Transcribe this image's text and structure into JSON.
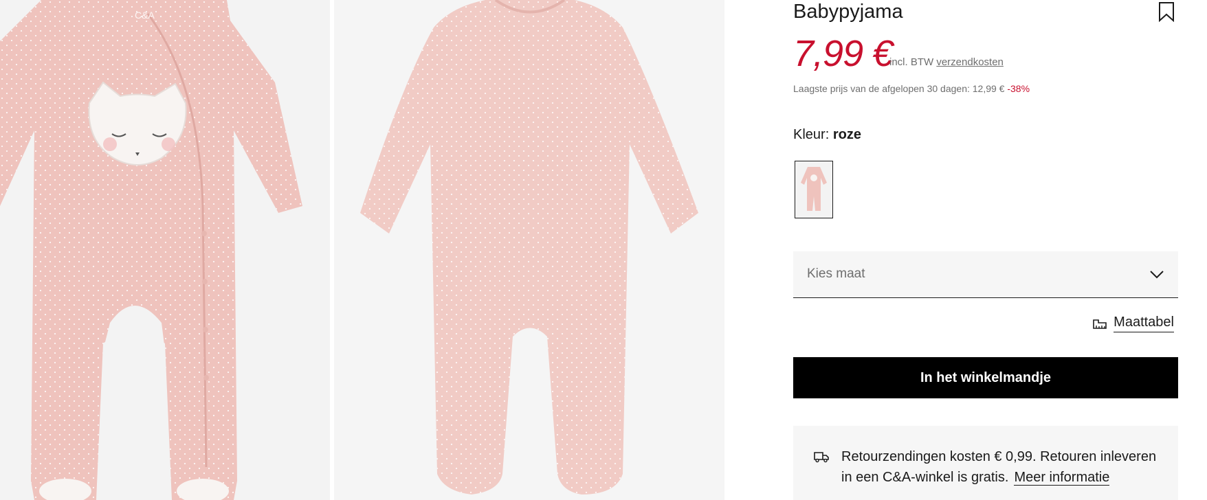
{
  "product": {
    "title": "Babypyjama",
    "price": "7,99 €",
    "vat_text": "incl. BTW",
    "shipping_link": "verzendkosten",
    "lowest_price_text": "Laagste prijs van de afgelopen 30 dagen: 12,99 €",
    "discount": "-38%"
  },
  "gallery": {
    "brand_mark": "C&A",
    "images": [
      "front-view",
      "back-view"
    ],
    "fabric_color": "#f0c6c0"
  },
  "color": {
    "label": "Kleur:",
    "value": "roze"
  },
  "size": {
    "placeholder": "Kies maat",
    "size_table_label": "Maattabel"
  },
  "cart": {
    "button_label": "In het winkelmandje"
  },
  "returns": {
    "text": "Retourzendingen kosten € 0,99. Retouren inleveren in een C&A-winkel is gratis.",
    "link": "Meer informatie"
  },
  "icons": {
    "bookmark": "bookmark-icon",
    "chevron": "chevron-down-icon",
    "size_table": "ruler-icon",
    "returns": "truck-icon"
  },
  "colors": {
    "price_red": "#c8102e",
    "button_black": "#000000",
    "panel_gray": "#f6f6f6"
  }
}
